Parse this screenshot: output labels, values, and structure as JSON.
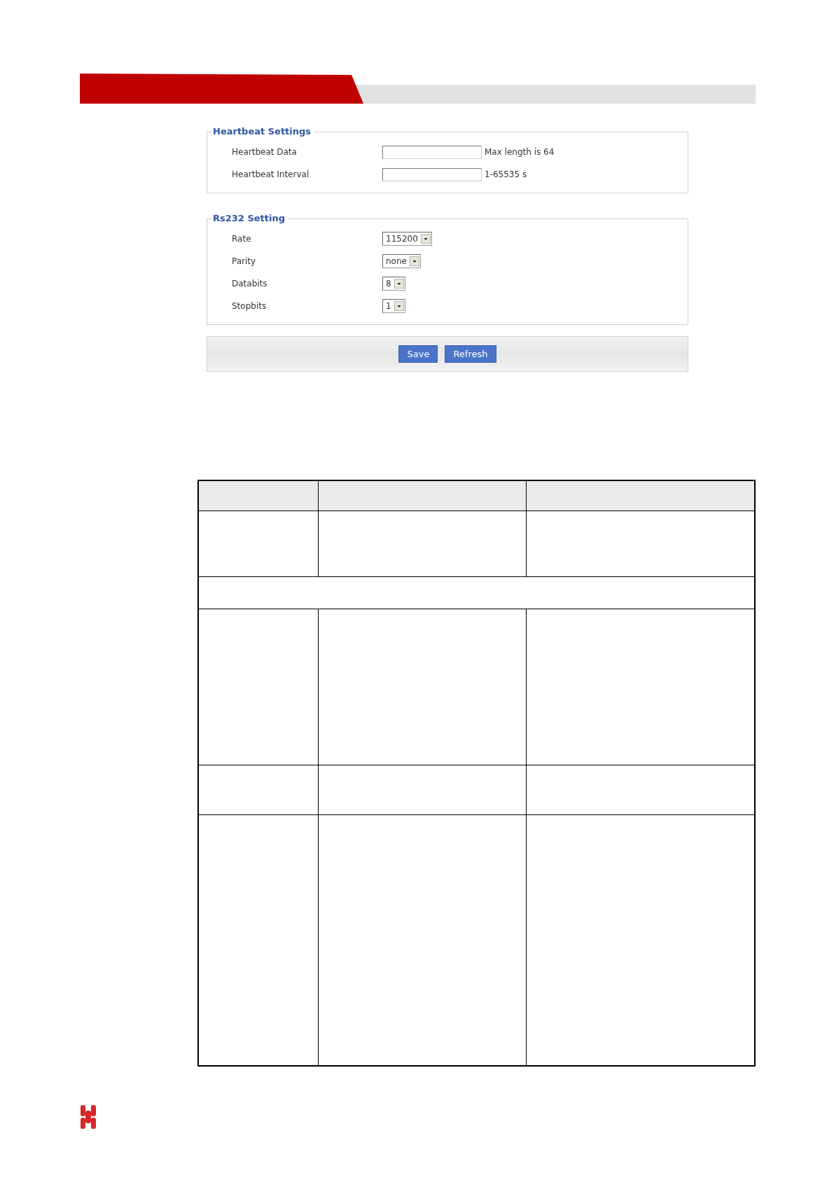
{
  "heartbeat_settings": {
    "title": "Heartbeat Settings",
    "fields": [
      {
        "label": "Heartbeat Data",
        "hint": "Max length is 64"
      },
      {
        "label": "Heartbeat Interval",
        "hint": "1-65535 s"
      }
    ]
  },
  "rs232_setting": {
    "title": "Rs232 Setting",
    "fields": [
      {
        "label": "Rate",
        "value": "115200"
      },
      {
        "label": "Parity",
        "value": "none"
      },
      {
        "label": "Databits",
        "value": "8"
      },
      {
        "label": "Stopbits",
        "value": "1"
      }
    ]
  },
  "buttons": [
    "Save",
    "Refresh"
  ]
}
